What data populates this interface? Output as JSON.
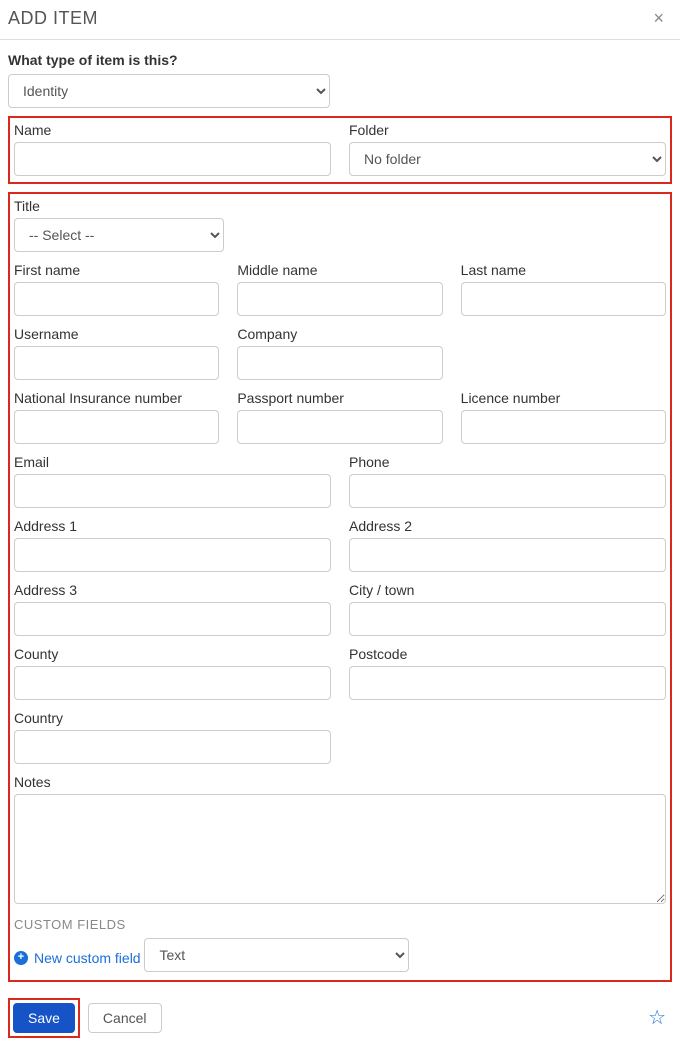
{
  "header": {
    "title": "ADD ITEM",
    "close_glyph": "×"
  },
  "typeSection": {
    "label": "What type of item is this?",
    "selected": "Identity"
  },
  "nameFolder": {
    "name_label": "Name",
    "name_value": "",
    "folder_label": "Folder",
    "folder_selected": "No folder"
  },
  "identity": {
    "title_label": "Title",
    "title_selected": "-- Select --",
    "first_name_label": "First name",
    "middle_name_label": "Middle name",
    "last_name_label": "Last name",
    "username_label": "Username",
    "company_label": "Company",
    "nin_label": "National Insurance number",
    "passport_label": "Passport number",
    "licence_label": "Licence number",
    "email_label": "Email",
    "phone_label": "Phone",
    "address1_label": "Address 1",
    "address2_label": "Address 2",
    "address3_label": "Address 3",
    "city_label": "City / town",
    "county_label": "County",
    "postcode_label": "Postcode",
    "country_label": "Country",
    "notes_label": "Notes"
  },
  "customFields": {
    "header": "CUSTOM FIELDS",
    "new_link": "New custom field",
    "type_selected": "Text"
  },
  "footer": {
    "save_label": "Save",
    "cancel_label": "Cancel",
    "star_glyph": "☆"
  }
}
